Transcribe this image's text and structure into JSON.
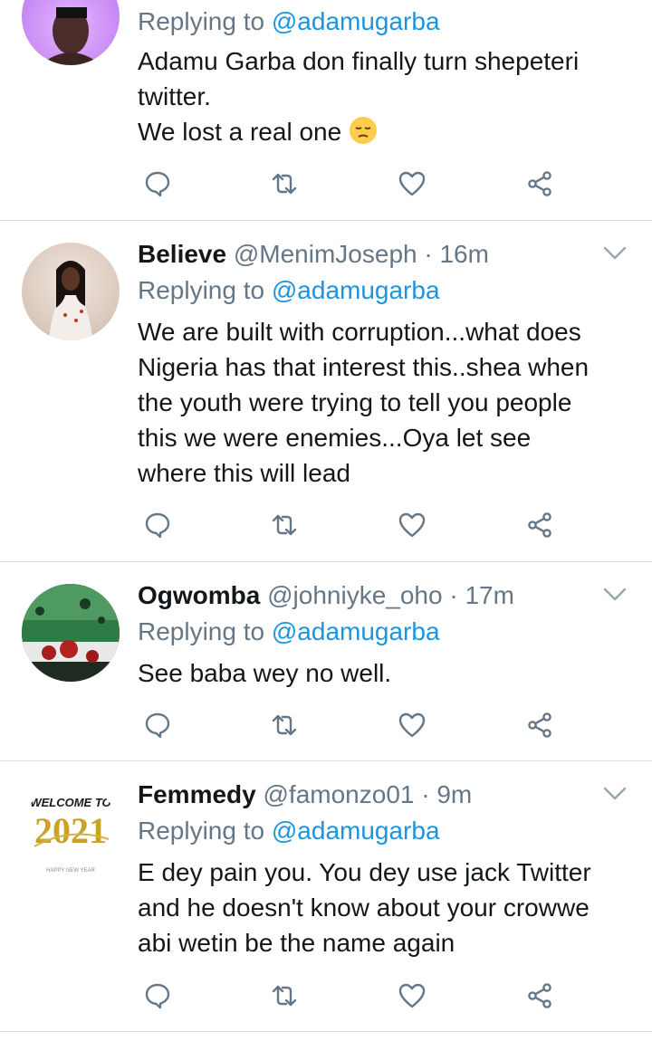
{
  "colors": {
    "text": "#14171a",
    "secondary": "#657786",
    "link": "#1b95e0",
    "divider": "#d9dee2",
    "icon": "#657786"
  },
  "tweets": [
    {
      "name": "",
      "handle": "",
      "time": "",
      "replying_label": "Replying to",
      "replying_to": "@adamugarba",
      "lines": [
        "Adamu Garba don finally turn shepeteri",
        "twitter.",
        "We lost a real one"
      ],
      "emoji": "pensive-face"
    },
    {
      "name": "Believe",
      "handle": "@MenimJoseph",
      "time": "· 16m",
      "replying_label": "Replying to",
      "replying_to": "@adamugarba",
      "lines": [
        "We are built with corruption...what does",
        "Nigeria has that interest this..shea when",
        "the youth were trying to tell you people",
        "this we were enemies...Oya let see",
        "where this will lead"
      ]
    },
    {
      "name": "Ogwomba",
      "handle": "@johniyke_oho",
      "time": "· 17m",
      "replying_label": "Replying to",
      "replying_to": "@adamugarba",
      "lines": [
        "See baba wey no well."
      ]
    },
    {
      "name": "Femmedy",
      "handle": "@famonzo01",
      "time": "· 9m",
      "replying_label": "Replying to",
      "replying_to": "@adamugarba",
      "lines": [
        "E dey pain you. You dey use jack Twitter",
        "and he doesn't know about your crowwe",
        "abi wetin be the name again"
      ],
      "avatar_text": [
        "WELCOME TO",
        "2021",
        "HAPPY NEW YEAR"
      ]
    }
  ]
}
